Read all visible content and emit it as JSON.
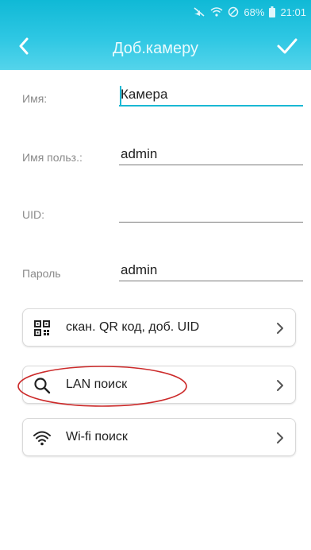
{
  "status_bar": {
    "battery": "68%",
    "time": "21:01"
  },
  "header": {
    "title": "Доб.камеру"
  },
  "form": {
    "name": {
      "label": "Имя:",
      "value": "Камера"
    },
    "username": {
      "label": "Имя польз.:",
      "value": "admin"
    },
    "uid": {
      "label": "UID:",
      "value": ""
    },
    "password": {
      "label": "Пароль",
      "value": "admin"
    }
  },
  "actions": [
    {
      "label": "скан. QR код, доб. UID",
      "icon": "qr-code-icon"
    },
    {
      "label": "LAN поиск",
      "icon": "search-icon"
    },
    {
      "label": "Wi-fi поиск",
      "icon": "wifi-icon"
    }
  ],
  "colors": {
    "accent": "#1ab8d4",
    "header_top": "#10b9d6",
    "header_bottom": "#54d4eb",
    "highlight": "#cc2a2a"
  }
}
